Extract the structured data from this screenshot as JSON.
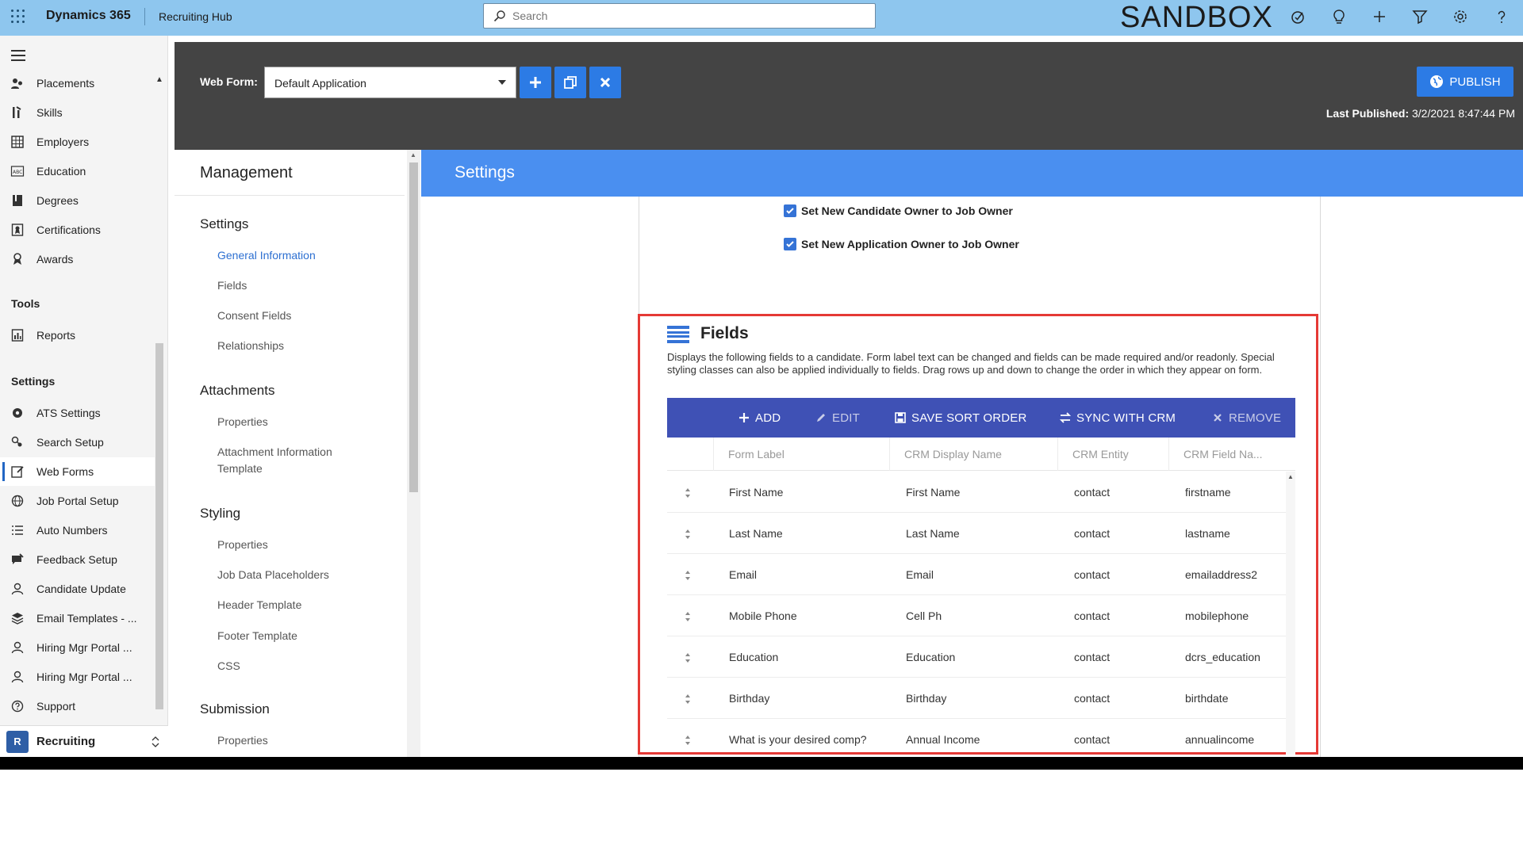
{
  "app": {
    "name": "Dynamics 365",
    "hub": "Recruiting Hub",
    "environment": "SANDBOX",
    "search_placeholder": "Search",
    "top_icons": [
      "task-icon",
      "lightbulb-icon",
      "plus-icon",
      "filter-icon",
      "settings-icon",
      "help-icon"
    ]
  },
  "nav": {
    "items_top": [
      {
        "label": "Placements",
        "icon": "people-icon"
      },
      {
        "label": "Skills",
        "icon": "skills-icon"
      },
      {
        "label": "Employers",
        "icon": "building-icon"
      },
      {
        "label": "Education",
        "icon": "abc-icon"
      },
      {
        "label": "Degrees",
        "icon": "book-icon"
      },
      {
        "label": "Certifications",
        "icon": "certificate-icon"
      },
      {
        "label": "Awards",
        "icon": "award-icon"
      }
    ],
    "tools_group": "Tools",
    "tools_items": [
      {
        "label": "Reports",
        "icon": "report-icon"
      }
    ],
    "settings_group": "Settings",
    "settings_items": [
      {
        "label": "ATS Settings",
        "icon": "gear-icon"
      },
      {
        "label": "Search Setup",
        "icon": "search-setup-icon"
      },
      {
        "label": "Web Forms",
        "icon": "webform-icon",
        "active": true
      },
      {
        "label": "Job Portal Setup",
        "icon": "globe-icon"
      },
      {
        "label": "Auto Numbers",
        "icon": "list-icon"
      },
      {
        "label": "Feedback Setup",
        "icon": "feedback-icon"
      },
      {
        "label": "Candidate Update",
        "icon": "person-icon"
      },
      {
        "label": "Email Templates - ...",
        "icon": "stack-icon"
      },
      {
        "label": "Hiring Mgr Portal ...",
        "icon": "person-icon"
      },
      {
        "label": "Hiring Mgr Portal ...",
        "icon": "person-icon"
      },
      {
        "label": "Support",
        "icon": "question-icon"
      }
    ],
    "area": {
      "badge": "R",
      "label": "Recruiting"
    }
  },
  "formbar": {
    "web_form_label": "Web Form:",
    "web_form_value": "Default Application",
    "publish_label": "PUBLISH",
    "last_published_label": "Last Published:",
    "last_published_value": "3/2/2021 8:47:44 PM"
  },
  "management": {
    "title": "Management",
    "sections": [
      {
        "title": "Settings",
        "links": [
          "General Information",
          "Fields",
          "Consent Fields",
          "Relationships"
        ]
      },
      {
        "title": "Attachments",
        "links": [
          "Properties",
          "Attachment Information Template"
        ]
      },
      {
        "title": "Styling",
        "links": [
          "Properties",
          "Job Data Placeholders",
          "Header Template",
          "Footer Template",
          "CSS"
        ]
      },
      {
        "title": "Submission",
        "links": [
          "Properties"
        ]
      }
    ],
    "active_link": "General Information"
  },
  "settings": {
    "title": "Settings",
    "checkboxes": [
      {
        "label": "Set New Candidate Owner to Job Owner",
        "checked": true
      },
      {
        "label": "Set New Application Owner to Job Owner",
        "checked": true
      }
    ]
  },
  "fields": {
    "title": "Fields",
    "description": "Displays the following fields to a candidate. Form label text can be changed and fields can be made required and/or readonly. Special styling classes can also be applied individually to fields. Drag rows up and down to change the order in which they appear on form.",
    "toolbar": {
      "add": "ADD",
      "edit": "EDIT",
      "save_sort": "SAVE SORT ORDER",
      "sync": "SYNC WITH CRM",
      "remove": "REMOVE"
    },
    "columns": [
      "Form Label",
      "CRM Display Name",
      "CRM Entity",
      "CRM Field Na..."
    ],
    "rows": [
      [
        "First Name",
        "First Name",
        "contact",
        "firstname"
      ],
      [
        "Last Name",
        "Last Name",
        "contact",
        "lastname"
      ],
      [
        "Email",
        "Email",
        "contact",
        "emailaddress2"
      ],
      [
        "Mobile Phone",
        "Cell Ph",
        "contact",
        "mobilephone"
      ],
      [
        "Education",
        "Education",
        "contact",
        "dcrs_education"
      ],
      [
        "Birthday",
        "Birthday",
        "contact",
        "birthdate"
      ],
      [
        "What is your desired comp?",
        "Annual Income",
        "contact",
        "annualincome"
      ]
    ]
  },
  "colors": {
    "topbar": "#8ec6ee",
    "header_dark": "#444444",
    "accent_blue": "#2c7be5",
    "settings_bar": "#4a8ff0",
    "toolbar_indigo": "#3f51b5",
    "highlight_red": "#e53935"
  }
}
